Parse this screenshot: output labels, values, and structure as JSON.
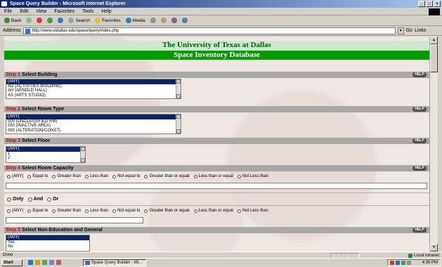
{
  "window": {
    "title": "Space Query Builder - Microsoft Internet Explorer"
  },
  "menu": [
    "File",
    "Edit",
    "View",
    "Favorites",
    "Tools",
    "Help"
  ],
  "toolbar": {
    "back": "Back",
    "search": "Search",
    "favorites": "Favorites",
    "media": "Media"
  },
  "address": {
    "label": "Address",
    "url": "http://www.utdallas.edu/space/query/index.php",
    "go": "Go",
    "links": "Links"
  },
  "page": {
    "university": "The University of Texas at Dallas",
    "database": "Space Inventory Database",
    "help_label": "HELP",
    "step_word": "Step",
    "steps": [
      {
        "num": "1",
        "label": "Select Building"
      },
      {
        "num": "2",
        "label": "Select Room Type"
      },
      {
        "num": "3",
        "label": "Select Floor"
      },
      {
        "num": "4",
        "label": "Select Room Capacity"
      },
      {
        "num": "5",
        "label": "Select Non-Education and General"
      }
    ],
    "building_options": [
      "(ANY)",
      "AD  (ACTIVITIES BUILDING)",
      "AH  (ARNOLD HALL)",
      "AS  (ARTS STUDIO)"
    ],
    "roomtype_options": [
      "(ANY)",
      "000  (UNCLASSIFIED RM)",
      "050  (INACTIVE AREA)",
      "060  (ALTERATION/CONST)"
    ],
    "floor_options": [
      "(ANY)",
      "1",
      "2"
    ],
    "capacity_ops": [
      "(ANY)",
      "Equal to",
      "Greater than",
      "Less than",
      "Not equal to",
      "Greater than or equal",
      "Less than or equal",
      "Not Less than"
    ],
    "logic_ops": [
      "Only",
      "And",
      "Or"
    ],
    "capacity_ops_2": [
      "(ANY)",
      "Equal to",
      "Greater than",
      "Less than",
      "Not equal to",
      "Greater than or equal",
      "Less than or equal",
      "Not Less than"
    ],
    "ne_options": [
      "(ANY)",
      "Yes",
      "No"
    ]
  },
  "status": {
    "left": "Done",
    "zone": "Local intranet"
  },
  "taskbar": {
    "start": "Start",
    "task": "Space Query Builder - Mi...",
    "clock": "4:35 PM"
  }
}
